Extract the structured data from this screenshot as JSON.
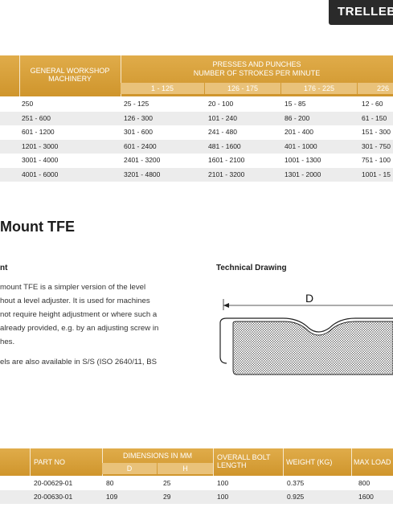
{
  "brand": {
    "logo_text": "TRELLEB"
  },
  "frequency_table": {
    "general_header": "GENERAL WORKSHOP MACHINERY",
    "presses_header_line1": "PRESSES AND PUNCHES",
    "presses_header_line2": "NUMBER OF STROKES PER MINUTE",
    "stroke_ranges": [
      "1 - 125",
      "126 - 175",
      "176 - 225",
      "226"
    ],
    "rows": [
      [
        "250",
        "25 - 125",
        "20 - 100",
        "15 - 85",
        "12 - 60"
      ],
      [
        "251 - 600",
        "126 - 300",
        "101 - 240",
        "86 - 200",
        "61 - 150"
      ],
      [
        "601 - 1200",
        "301 - 600",
        "241 - 480",
        "201 - 400",
        "151 - 300"
      ],
      [
        "1201 - 3000",
        "601 - 2400",
        "481 - 1600",
        "401 - 1000",
        "301 - 750"
      ],
      [
        "3001 - 4000",
        "2401 - 3200",
        "1601 - 2100",
        "1001 - 1300",
        "751 - 100"
      ],
      [
        "4001 - 6000",
        "3201 - 4800",
        "2101 - 3200",
        "1301 - 2000",
        "1001 - 15"
      ]
    ]
  },
  "section": {
    "title": "Mount TFE",
    "left_subhead": "nt",
    "right_subhead": "Technical Drawing",
    "paragraph1_lines": [
      "mount TFE is a simpler version of the level",
      "hout a level adjuster. It is used for machines",
      "not require height adjustment or where such a",
      "already provided, e.g. by an adjusting screw in",
      "hes."
    ],
    "paragraph2_lines": [
      "els are also available in S/S (ISO 2640/11, BS"
    ],
    "drawing_label": "D"
  },
  "parts_table": {
    "headers": {
      "part_no": "PART NO",
      "dimensions": "DIMENSIONS IN MM",
      "dim_d": "D",
      "dim_h": "H",
      "bolt_length": "OVERALL BOLT LENGTH",
      "weight": "WEIGHT (KG)",
      "max_load": "MAX LOAD"
    },
    "rows": [
      {
        "part_no": "20-00629-01",
        "d": "80",
        "h": "25",
        "bolt": "100",
        "weight": "0.375",
        "max_load": "800"
      },
      {
        "part_no": "20-00630-01",
        "d": "109",
        "h": "29",
        "bolt": "100",
        "weight": "0.925",
        "max_load": "1600"
      }
    ]
  }
}
